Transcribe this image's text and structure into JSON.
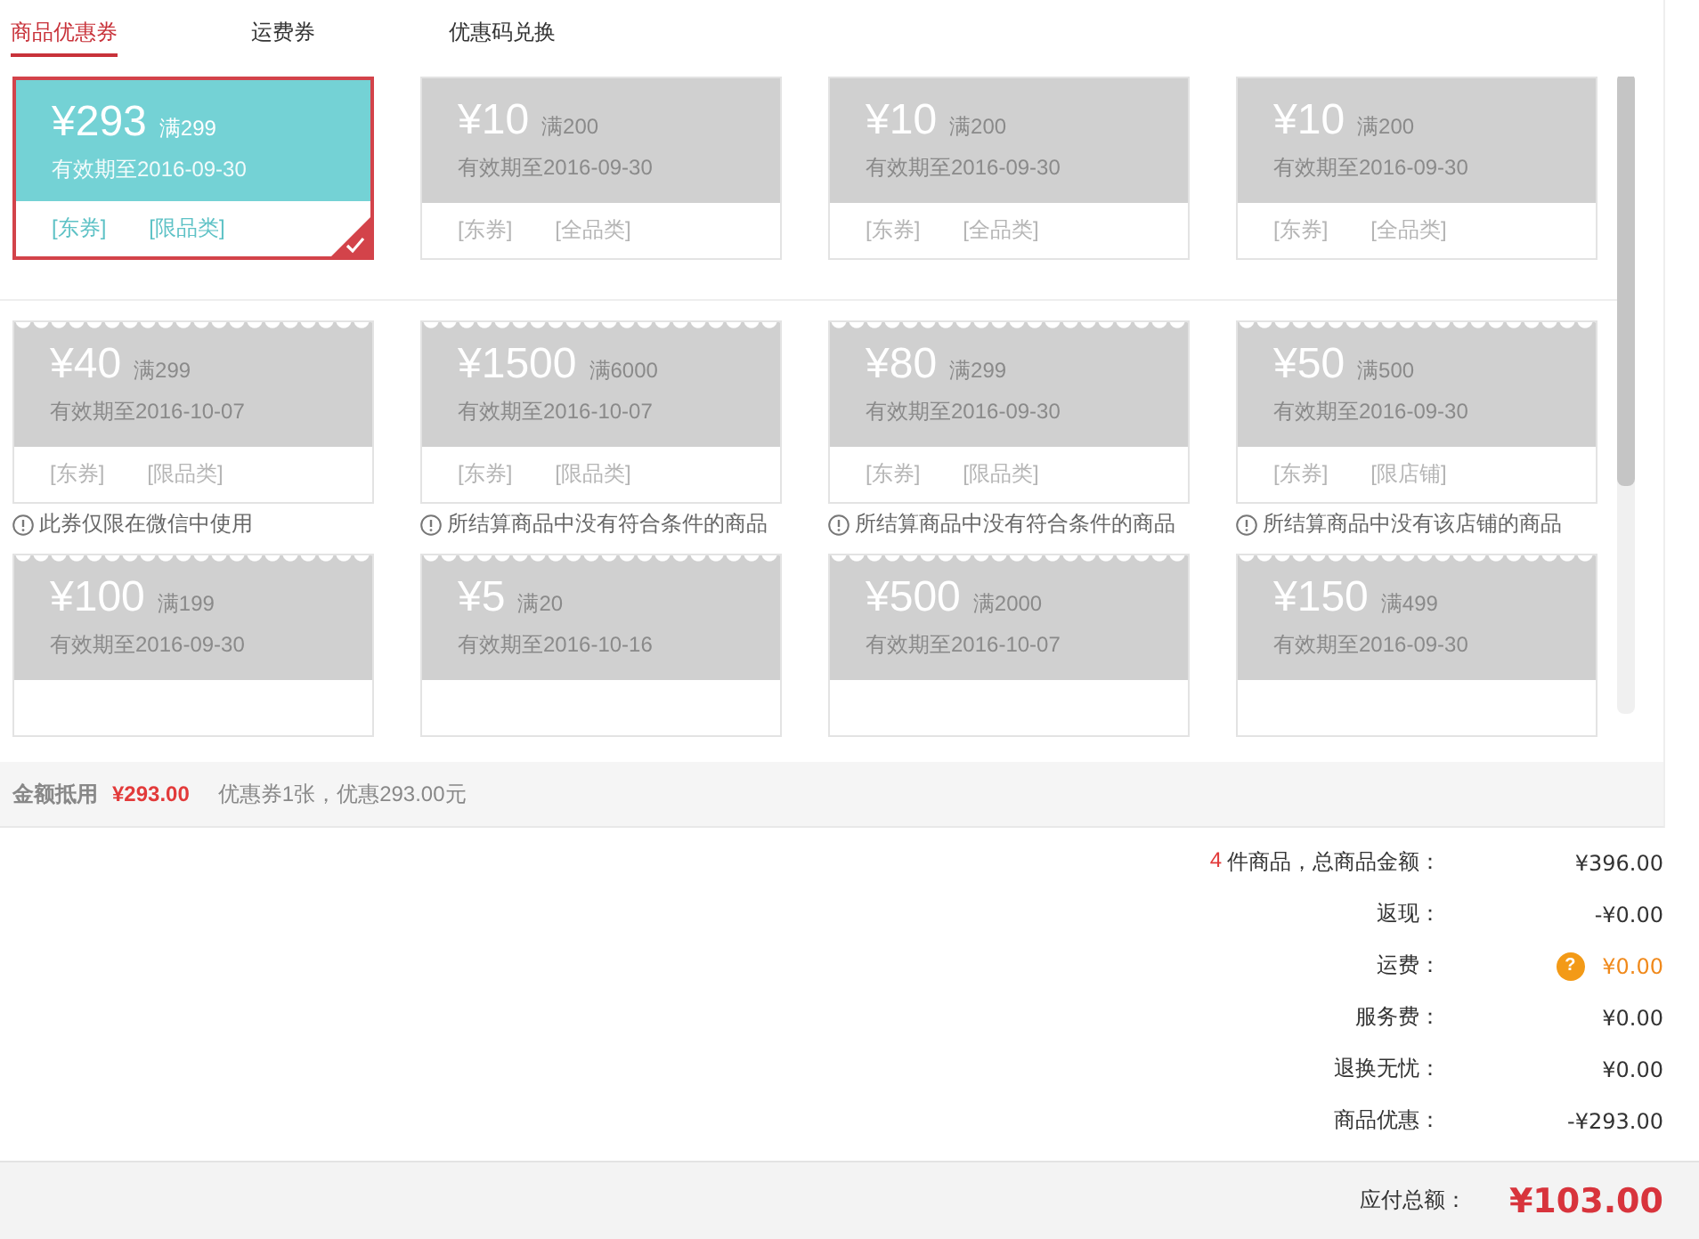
{
  "tabs": [
    {
      "label": "商品优惠券",
      "selected": true
    },
    {
      "label": "运费券",
      "selected": false
    },
    {
      "label": "优惠码兑换",
      "selected": false
    }
  ],
  "coupon_groups": [
    {
      "kind": "usable",
      "coupons": [
        {
          "amount": "¥293",
          "condition": "满299",
          "expiry": "有效期至2016-09-30",
          "tags": [
            "[东券]",
            "[限品类]"
          ],
          "selected": true
        },
        {
          "amount": "¥10",
          "condition": "满200",
          "expiry": "有效期至2016-09-30",
          "tags": [
            "[东券]",
            "[全品类]"
          ],
          "selected": false
        },
        {
          "amount": "¥10",
          "condition": "满200",
          "expiry": "有效期至2016-09-30",
          "tags": [
            "[东券]",
            "[全品类]"
          ],
          "selected": false
        },
        {
          "amount": "¥10",
          "condition": "满200",
          "expiry": "有效期至2016-09-30",
          "tags": [
            "[东券]",
            "[全品类]"
          ],
          "selected": false
        }
      ]
    },
    {
      "kind": "unusable",
      "coupons": [
        {
          "amount": "¥40",
          "condition": "满299",
          "expiry": "有效期至2016-10-07",
          "tags": [
            "[东券]",
            "[限品类]"
          ],
          "note": "此券仅限在微信中使用"
        },
        {
          "amount": "¥1500",
          "condition": "满6000",
          "expiry": "有效期至2016-10-07",
          "tags": [
            "[东券]",
            "[限品类]"
          ],
          "note": "所结算商品中没有符合条件的商品"
        },
        {
          "amount": "¥80",
          "condition": "满299",
          "expiry": "有效期至2016-09-30",
          "tags": [
            "[东券]",
            "[限品类]"
          ],
          "note": "所结算商品中没有符合条件的商品"
        },
        {
          "amount": "¥50",
          "condition": "满500",
          "expiry": "有效期至2016-09-30",
          "tags": [
            "[东券]",
            "[限店铺]"
          ],
          "note": "所结算商品中没有该店铺的商品"
        },
        {
          "amount": "¥100",
          "condition": "满199",
          "expiry": "有效期至2016-09-30"
        },
        {
          "amount": "¥5",
          "condition": "满20",
          "expiry": "有效期至2016-10-16"
        },
        {
          "amount": "¥500",
          "condition": "满2000",
          "expiry": "有效期至2016-10-07"
        },
        {
          "amount": "¥150",
          "condition": "满499",
          "expiry": "有效期至2016-09-30"
        }
      ]
    }
  ],
  "deduction": {
    "label": "金额抵用",
    "amount": "¥293.00",
    "detail": "优惠券1张，优惠293.00元"
  },
  "summary": [
    {
      "count": "4",
      "label": "件商品，总商品金额：",
      "value": "¥396.00",
      "highlight": false
    },
    {
      "label": "返现：",
      "value": "-¥0.00",
      "highlight": false
    },
    {
      "label": "运费：",
      "help": "?",
      "value": "¥0.00",
      "highlight": true
    },
    {
      "label": "服务费：",
      "value": "¥0.00",
      "highlight": false
    },
    {
      "label": "退换无忧：",
      "value": "¥0.00",
      "highlight": false
    },
    {
      "label": "商品优惠：",
      "value": "-¥293.00",
      "highlight": false
    }
  ],
  "total": {
    "label": "应付总额：",
    "value": "¥103.00"
  }
}
